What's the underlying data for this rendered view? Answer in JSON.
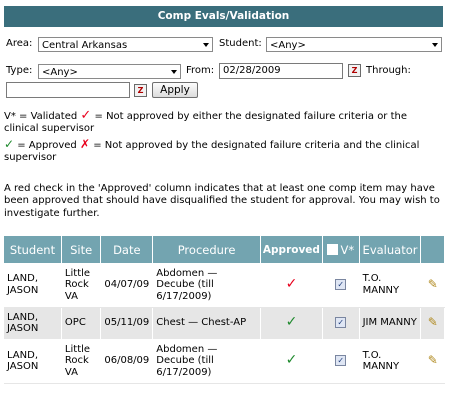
{
  "header": {
    "title": "Comp Evals/Validation"
  },
  "filters": {
    "area_label": "Area:",
    "area_value": "Central Arkansas",
    "student_label": "Student:",
    "student_value": "<Any>",
    "type_label": "Type:",
    "type_value": "<Any>",
    "from_label": "From:",
    "from_value": "02/28/2009",
    "through_label": "Through:",
    "through_value": "",
    "apply_label": "Apply"
  },
  "legend": {
    "validated_prefix": "V* = Validated",
    "validated_text": "= Not approved by either the designated failure criteria or the clinical supervisor",
    "approved_text": "= Approved",
    "not_approved_text": "= Not approved by the designated failure criteria and the clinical supervisor"
  },
  "info_text": "A red check in the 'Approved' column indicates that at least one comp item may have been approved that should have disqualified the student for approval. You may wish to investigate further.",
  "table": {
    "columns": [
      "Student",
      "Site",
      "Date",
      "Procedure",
      "Approved",
      "V*",
      "Evaluator",
      ""
    ],
    "rows": [
      {
        "student": "LAND, JASON",
        "site": "Little Rock VA",
        "date": "04/07/09",
        "procedure": "Abdomen — Decube (till 6/17/2009)",
        "approved": "red",
        "validated": true,
        "evaluator": "T.O. MANNY"
      },
      {
        "student": "LAND, JASON",
        "site": "OPC",
        "date": "05/11/09",
        "procedure": "Chest — Chest-AP",
        "approved": "green",
        "validated": true,
        "evaluator": "JIM MANNY"
      },
      {
        "student": "LAND, JASON",
        "site": "Little Rock VA",
        "date": "06/08/09",
        "procedure": "Abdomen — Decube (till 6/17/2009)",
        "approved": "green",
        "validated": true,
        "evaluator": "T.O. MANNY"
      }
    ]
  },
  "colors": {
    "title_bar": "#3a6e7c",
    "table_header": "#73a4b0",
    "approved_red": "#e8001c",
    "approved_green": "#1f8a2e"
  }
}
